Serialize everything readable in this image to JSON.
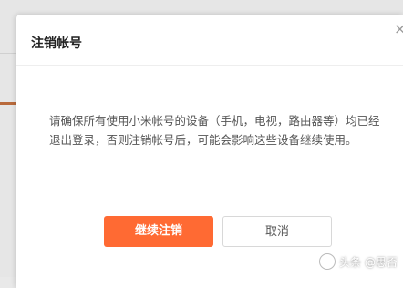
{
  "dialog": {
    "title": "注销帐号",
    "close_icon": "close-icon",
    "close_glyph": "×",
    "message": "请确保所有使用小米帐号的设备（手机，电视，路由器等）均已经退出登录，否则注销帐号后，可能会影响这些设备继续使用。",
    "confirm_label": "继续注销",
    "cancel_label": "取消"
  },
  "watermark": {
    "text": "头条 @思否"
  },
  "colors": {
    "primary": "#ff6a33",
    "title": "#222222",
    "text": "#555555"
  }
}
